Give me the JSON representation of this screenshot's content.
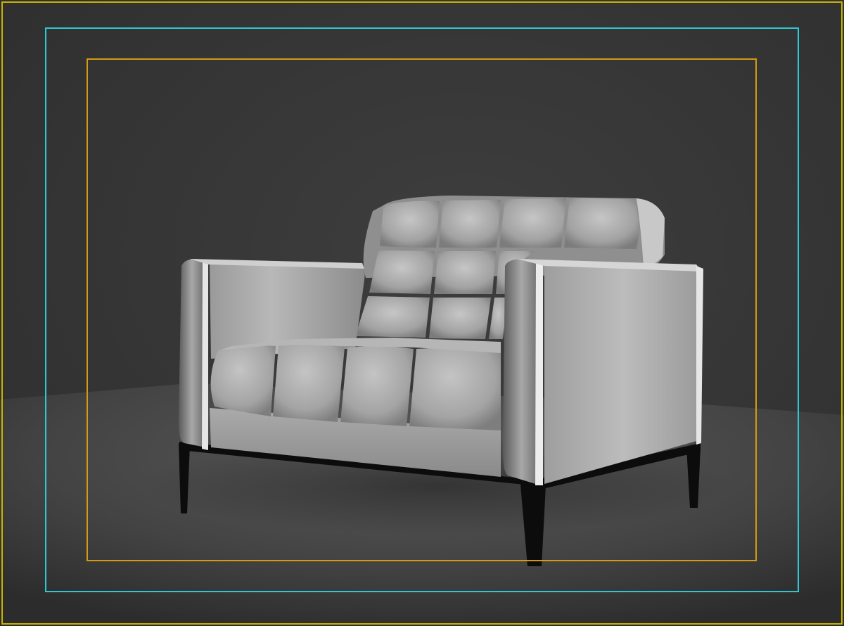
{
  "viewport": {
    "background_color": "#333333",
    "floor_color": "#4a4a4a",
    "object_icon": "armchair-icon"
  },
  "overlays": {
    "render_frame_color": "#c8b400",
    "safe_action_color": "#2fc7d1",
    "safe_title_color": "#d69a12"
  },
  "armchair": {
    "backrest_tufts": {
      "rows": 3,
      "columns": 4
    },
    "seat_tufts": {
      "rows": 1,
      "columns": 4
    },
    "leg_color": "#0c0c0c"
  }
}
